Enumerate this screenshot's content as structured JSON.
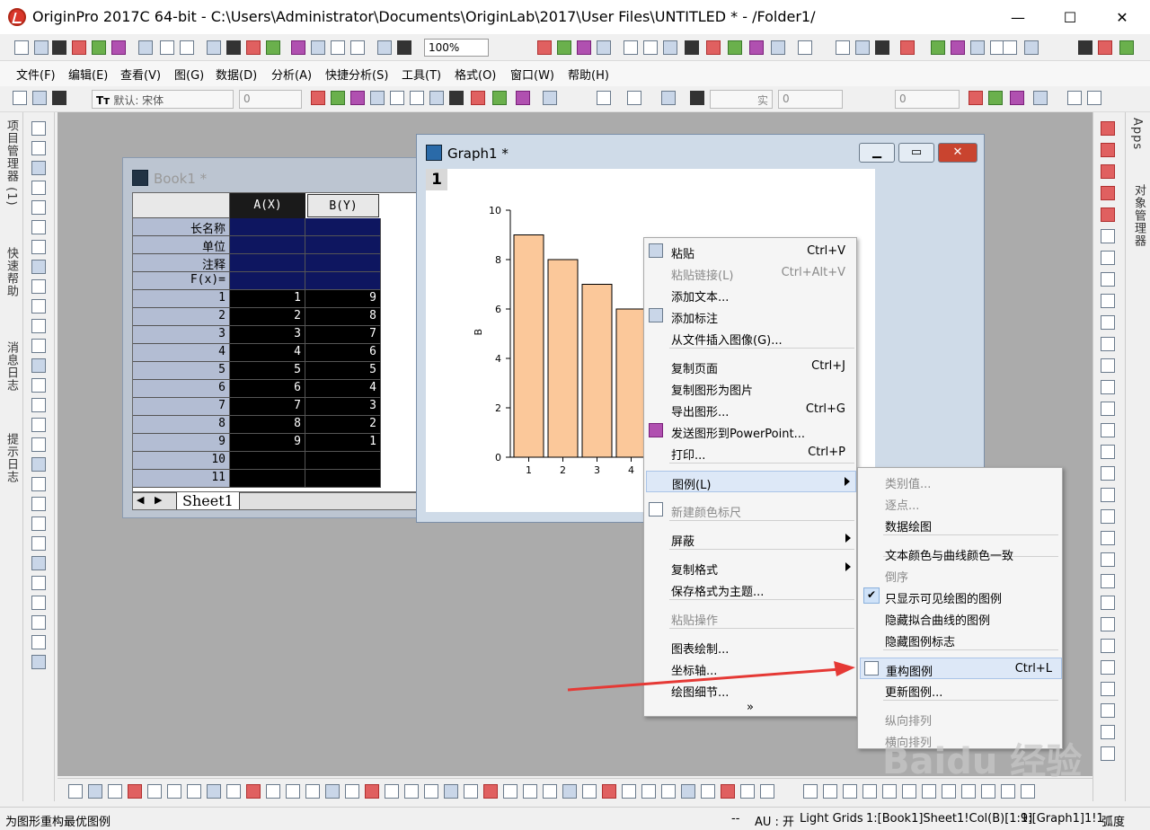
{
  "titlebar": {
    "title": "OriginPro 2017C 64-bit - C:\\Users\\Administrator\\Documents\\OriginLab\\2017\\User Files\\UNTITLED * - /Folder1/",
    "minimize": "—",
    "maximize": "☐",
    "close": "✕"
  },
  "toolbar": {
    "zoom": "100%",
    "font": "默认: 宋体",
    "size1": "0",
    "size2": "0",
    "size3": "0",
    "line": "实"
  },
  "menubar": [
    "文件(F)",
    "编辑(E)",
    "查看(V)",
    "图(G)",
    "数据(D)",
    "分析(A)",
    "快捷分析(S)",
    "工具(T)",
    "格式(O)",
    "窗口(W)",
    "帮助(H)"
  ],
  "left_tabs": [
    "项目管理器 (1)",
    "快速帮助",
    "消息日志",
    "提示日志"
  ],
  "right_tabs": [
    "Apps",
    "对象管理器"
  ],
  "book1": {
    "title": "Book1 *",
    "col_a": "A(X)",
    "col_b": "B(Y)",
    "meta_rows": [
      "长名称",
      "单位",
      "注释",
      "F(x)="
    ],
    "rows": [
      {
        "n": "1",
        "a": "1",
        "b": "9"
      },
      {
        "n": "2",
        "a": "2",
        "b": "8"
      },
      {
        "n": "3",
        "a": "3",
        "b": "7"
      },
      {
        "n": "4",
        "a": "4",
        "b": "6"
      },
      {
        "n": "5",
        "a": "5",
        "b": "5"
      },
      {
        "n": "6",
        "a": "6",
        "b": "4"
      },
      {
        "n": "7",
        "a": "7",
        "b": "3"
      },
      {
        "n": "8",
        "a": "8",
        "b": "2"
      },
      {
        "n": "9",
        "a": "9",
        "b": "1"
      },
      {
        "n": "10",
        "a": "",
        "b": ""
      },
      {
        "n": "11",
        "a": "",
        "b": ""
      }
    ],
    "sheet_tab": "Sheet1"
  },
  "graph1": {
    "title": "Graph1 *",
    "layer": "1"
  },
  "chart_data": {
    "type": "bar",
    "categories": [
      "1",
      "2",
      "3",
      "4"
    ],
    "values": [
      9,
      8,
      7,
      6
    ],
    "ylabel": "B",
    "yticks": [
      "0",
      "2",
      "4",
      "6",
      "8",
      "10"
    ],
    "ylim": [
      0,
      10
    ],
    "bar_color": "#fbc89a"
  },
  "context_menu": [
    {
      "label": "粘贴",
      "shortcut": "Ctrl+V",
      "disabled": false
    },
    {
      "label": "粘贴链接(L)",
      "shortcut": "Ctrl+Alt+V",
      "disabled": true
    },
    {
      "label": "添加文本...",
      "shortcut": "",
      "disabled": false
    },
    {
      "label": "添加标注",
      "shortcut": "",
      "disabled": false
    },
    {
      "label": "从文件插入图像(G)...",
      "shortcut": "",
      "disabled": false
    },
    {
      "label": "复制页面",
      "shortcut": "Ctrl+J",
      "disabled": false
    },
    {
      "label": "复制图形为图片",
      "shortcut": "",
      "disabled": false
    },
    {
      "label": "导出图形...",
      "shortcut": "Ctrl+G",
      "disabled": false
    },
    {
      "label": "发送图形到PowerPoint...",
      "shortcut": "",
      "disabled": false
    },
    {
      "label": "打印...",
      "shortcut": "Ctrl+P",
      "disabled": false
    },
    {
      "label": "图例(L)",
      "shortcut": "",
      "disabled": false
    },
    {
      "label": "新建颜色标尺",
      "shortcut": "",
      "disabled": true
    },
    {
      "label": "屏蔽",
      "shortcut": "",
      "disabled": false
    },
    {
      "label": "复制格式",
      "shortcut": "",
      "disabled": false
    },
    {
      "label": "保存格式为主题...",
      "shortcut": "",
      "disabled": false
    },
    {
      "label": "粘贴操作",
      "shortcut": "",
      "disabled": true
    },
    {
      "label": "图表绘制...",
      "shortcut": "",
      "disabled": false
    },
    {
      "label": "坐标轴...",
      "shortcut": "",
      "disabled": false
    },
    {
      "label": "绘图细节...",
      "shortcut": "",
      "disabled": false
    },
    {
      "label": "»",
      "shortcut": "",
      "disabled": false
    }
  ],
  "submenu": [
    {
      "label": "类别值...",
      "shortcut": "",
      "disabled": true
    },
    {
      "label": "逐点...",
      "shortcut": "",
      "disabled": true
    },
    {
      "label": "数据绘图",
      "shortcut": "",
      "disabled": false
    },
    {
      "label": "文本颜色与曲线颜色一致",
      "shortcut": "",
      "disabled": false
    },
    {
      "label": "倒序",
      "shortcut": "",
      "disabled": true
    },
    {
      "label": "只显示可见绘图的图例",
      "shortcut": "",
      "disabled": false
    },
    {
      "label": "隐藏拟合曲线的图例",
      "shortcut": "",
      "disabled": false
    },
    {
      "label": "隐藏图例标志",
      "shortcut": "",
      "disabled": false
    },
    {
      "label": "重构图例",
      "shortcut": "Ctrl+L",
      "disabled": false
    },
    {
      "label": "更新图例...",
      "shortcut": "",
      "disabled": false
    },
    {
      "label": "纵向排列",
      "shortcut": "",
      "disabled": true
    },
    {
      "label": "横向排列",
      "shortcut": "",
      "disabled": true
    }
  ],
  "statusbar": {
    "message": "为图形重构最优图例",
    "dash": "--",
    "au": "AU : 开",
    "grids": "Light Grids",
    "cell": "1:[Book1]Sheet1!Col(B)[1:9]",
    "graph": "1:[Graph1]1!1",
    "unit": "弧度"
  },
  "watermark": "Baidu 经验",
  "colors": {
    "workspace": "#ababab",
    "arrow": "#e53935",
    "bar": "#fbc89a"
  }
}
